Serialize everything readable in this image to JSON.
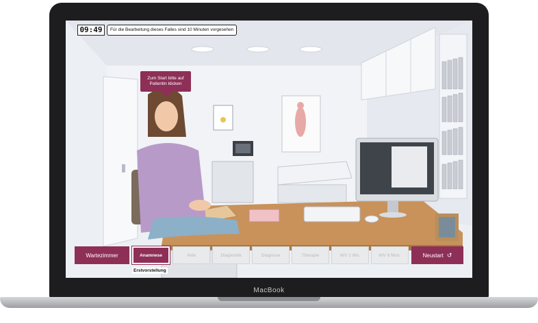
{
  "device": {
    "brand": "MacBook"
  },
  "header": {
    "timer": "09:49",
    "hint": "Für die Bearbeitung dieses Falles sind 10 Minuten vorgesehen"
  },
  "scene": {
    "bubble_text": "Zum Start bitte auf Patientin klicken"
  },
  "nav": {
    "waiting_room": "Wartezimmer",
    "steps": [
      {
        "label": "Anamnese",
        "state": "active"
      },
      {
        "label": "Akte",
        "state": "disabled"
      },
      {
        "label": "Diagnostik",
        "state": "disabled"
      },
      {
        "label": "Diagnose",
        "state": "disabled"
      },
      {
        "label": "Therapie",
        "state": "disabled"
      },
      {
        "label": "WV 2 Wo.",
        "state": "disabled"
      },
      {
        "label": "WV 6 Mon.",
        "state": "disabled"
      }
    ],
    "restart": "Neustart",
    "sub_label": "Erstvorstellung"
  },
  "colors": {
    "accent": "#8e2f57",
    "disabled_bg": "#e9eaec",
    "disabled_text": "#b9b9bd"
  }
}
